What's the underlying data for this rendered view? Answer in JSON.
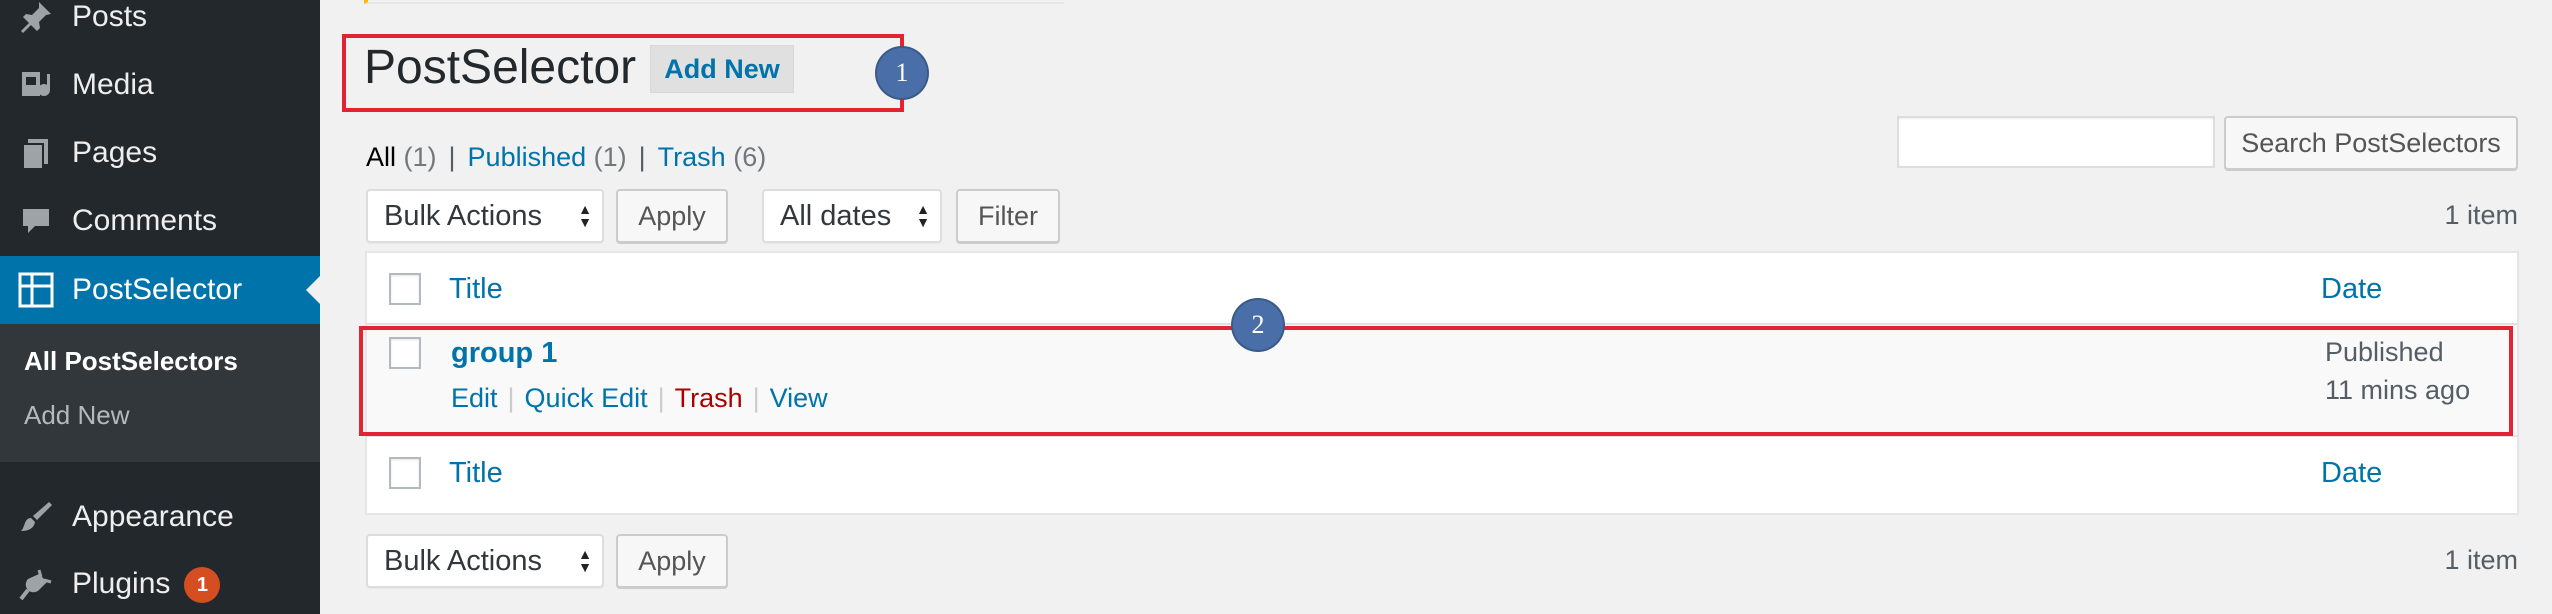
{
  "sidebar": {
    "items": [
      {
        "label": "Posts",
        "icon": "pin-icon"
      },
      {
        "label": "Media",
        "icon": "media-icon"
      },
      {
        "label": "Pages",
        "icon": "pages-icon"
      },
      {
        "label": "Comments",
        "icon": "comment-icon"
      },
      {
        "label": "PostSelector",
        "icon": "grid-icon",
        "active": true
      },
      {
        "label": "Appearance",
        "icon": "brush-icon"
      },
      {
        "label": "Plugins",
        "icon": "plug-icon",
        "badge": "1"
      }
    ],
    "submenu": {
      "all": "All PostSelectors",
      "add": "Add New"
    }
  },
  "header": {
    "title": "PostSelector",
    "add_new": "Add New"
  },
  "annotations": {
    "one": "1",
    "two": "2"
  },
  "filters": {
    "all": "All",
    "all_count": "(1)",
    "sep": "|",
    "published": "Published",
    "published_count": "(1)",
    "trash": "Trash",
    "trash_count": "(6)"
  },
  "search": {
    "placeholder": "",
    "button": "Search PostSelectors"
  },
  "tablenav": {
    "bulk_actions": "Bulk Actions",
    "apply": "Apply",
    "all_dates": "All dates",
    "filter": "Filter",
    "items_count": "1 item"
  },
  "table": {
    "col_title": "Title",
    "col_date": "Date",
    "rows": [
      {
        "title": "group 1",
        "actions": {
          "edit": "Edit",
          "quick_edit": "Quick Edit",
          "trash": "Trash",
          "view": "View"
        },
        "status": "Published",
        "ago": "11 mins ago"
      }
    ]
  },
  "colors": {
    "accent": "#0073aa",
    "sidebar_bg": "#23282d",
    "annotation_red": "#e22331",
    "trash_red": "#aa0000"
  }
}
